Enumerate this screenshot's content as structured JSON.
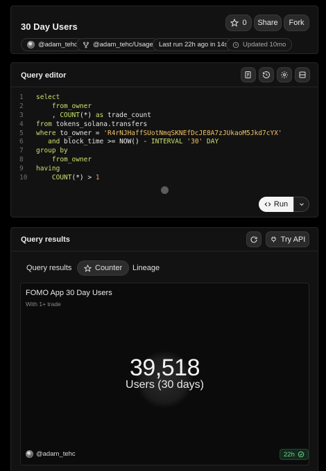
{
  "header": {
    "title": "30 Day Users",
    "star_count": "0",
    "share_label": "Share",
    "fork_label": "Fork",
    "author": "@adam_tehc",
    "repo": "@adam_tehc/Usage",
    "last_run": "Last run 22h ago in 14s",
    "updated": "Updated 10mo"
  },
  "editor": {
    "title": "Query editor",
    "run_label": "Run",
    "icons": [
      "format-icon",
      "history-icon",
      "settings-icon",
      "layout-icon"
    ]
  },
  "code_lines": [
    {
      "n": "1",
      "tokens": [
        {
          "t": "select",
          "c": "kw"
        }
      ]
    },
    {
      "n": "2",
      "tokens": [
        {
          "t": "    from_owner",
          "c": "kw"
        }
      ]
    },
    {
      "n": "3",
      "tokens": [
        {
          "t": "    , ",
          "c": "txt"
        },
        {
          "t": "COUNT",
          "c": "kw"
        },
        {
          "t": "(*)",
          "c": "fn"
        },
        {
          "t": " as ",
          "c": "kw"
        },
        {
          "t": "trade_count",
          "c": "txt"
        }
      ]
    },
    {
      "n": "4",
      "tokens": [
        {
          "t": "from ",
          "c": "kw"
        },
        {
          "t": "tokens_solana.transfers",
          "c": "txt"
        }
      ]
    },
    {
      "n": "5",
      "tokens": [
        {
          "t": "where ",
          "c": "kw"
        },
        {
          "t": "to_owner = ",
          "c": "txt"
        },
        {
          "t": "'R4rNJHaffSUotNmqSKNEfDcJE8A7zJUkaoM5Jkd7cYX'",
          "c": "str"
        }
      ]
    },
    {
      "n": "6",
      "tokens": [
        {
          "t": "   and ",
          "c": "kw"
        },
        {
          "t": "block_time >= ",
          "c": "txt"
        },
        {
          "t": "NOW()",
          "c": "fn"
        },
        {
          "t": " - ",
          "c": "txt"
        },
        {
          "t": "INTERVAL ",
          "c": "kw"
        },
        {
          "t": "'30'",
          "c": "str"
        },
        {
          "t": " DAY",
          "c": "kw"
        }
      ]
    },
    {
      "n": "7",
      "tokens": [
        {
          "t": "group by",
          "c": "kw"
        }
      ]
    },
    {
      "n": "8",
      "tokens": [
        {
          "t": "    from_owner",
          "c": "kw"
        }
      ]
    },
    {
      "n": "9",
      "tokens": [
        {
          "t": "having",
          "c": "kw"
        }
      ]
    },
    {
      "n": "10",
      "tokens": [
        {
          "t": "    COUNT",
          "c": "kw"
        },
        {
          "t": "(*)",
          "c": "fn"
        },
        {
          "t": " > ",
          "c": "txt"
        },
        {
          "t": "1",
          "c": "num"
        }
      ]
    }
  ],
  "results": {
    "title": "Query results",
    "try_api_label": "Try API",
    "tabs": [
      {
        "label": "Query results",
        "active": false
      },
      {
        "label": "Counter",
        "active": true
      },
      {
        "label": "Lineage",
        "active": false
      }
    ]
  },
  "counter": {
    "title": "FOMO App 30 Day Users",
    "subtitle": "With 1+ trade",
    "value": "39,518",
    "label": "Users (30 days)",
    "author": "@adam_tehc",
    "age": "22h"
  },
  "colors": {
    "background": "#000000",
    "card": "#121212",
    "keyword": "#c8e06e",
    "string": "#f0c36a",
    "number": "#f2a070",
    "success": "#6fcf8a"
  }
}
